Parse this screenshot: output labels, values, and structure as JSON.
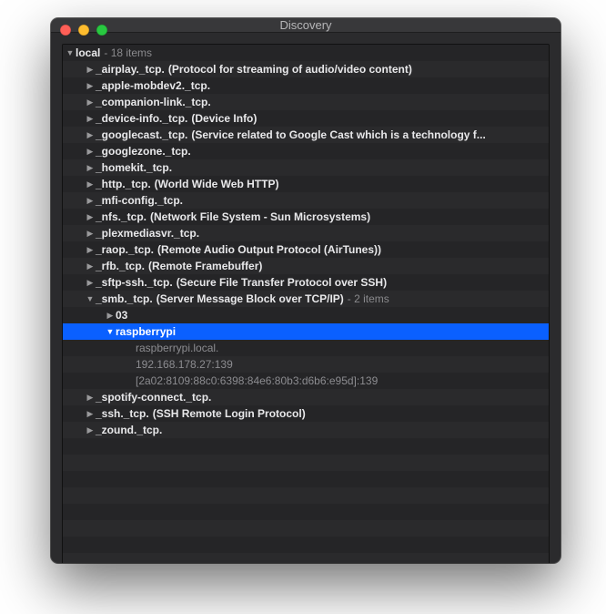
{
  "window": {
    "title": "Discovery"
  },
  "root": {
    "label": "local",
    "meta": "- 18 items"
  },
  "services": [
    {
      "name": "_airplay._tcp.",
      "desc": "(Protocol for streaming of audio/video content)"
    },
    {
      "name": "_apple-mobdev2._tcp.",
      "desc": ""
    },
    {
      "name": "_companion-link._tcp.",
      "desc": ""
    },
    {
      "name": "_device-info._tcp.",
      "desc": "(Device Info)"
    },
    {
      "name": "_googlecast._tcp.",
      "desc": "(Service related to Google Cast which is a technology f..."
    },
    {
      "name": "_googlezone._tcp.",
      "desc": ""
    },
    {
      "name": "_homekit._tcp.",
      "desc": ""
    },
    {
      "name": "_http._tcp.",
      "desc": "(World Wide Web HTTP)"
    },
    {
      "name": "_mfi-config._tcp.",
      "desc": ""
    },
    {
      "name": "_nfs._tcp.",
      "desc": "(Network File System - Sun Microsystems)"
    },
    {
      "name": "_plexmediasvr._tcp.",
      "desc": ""
    },
    {
      "name": "_raop._tcp.",
      "desc": "(Remote Audio Output Protocol (AirTunes))"
    },
    {
      "name": "_rfb._tcp.",
      "desc": "(Remote Framebuffer)"
    },
    {
      "name": "_sftp-ssh._tcp.",
      "desc": "(Secure File Transfer Protocol over SSH)"
    }
  ],
  "smb": {
    "name": "_smb._tcp.",
    "desc": "(Server Message Block over TCP/IP)",
    "meta": "- 2 items",
    "children": [
      {
        "name": "03",
        "expanded": false
      },
      {
        "name": "raspberrypi",
        "expanded": true,
        "selected": true,
        "details": [
          "raspberrypi.local.",
          "192.168.178.27:139",
          "[2a02:8109:88c0:6398:84e6:80b3:d6b6:e95d]:139"
        ]
      }
    ]
  },
  "after_smb": [
    {
      "name": "_spotify-connect._tcp.",
      "desc": ""
    },
    {
      "name": "_ssh._tcp.",
      "desc": "(SSH Remote Login Protocol)"
    },
    {
      "name": "_zound._tcp.",
      "desc": ""
    }
  ]
}
